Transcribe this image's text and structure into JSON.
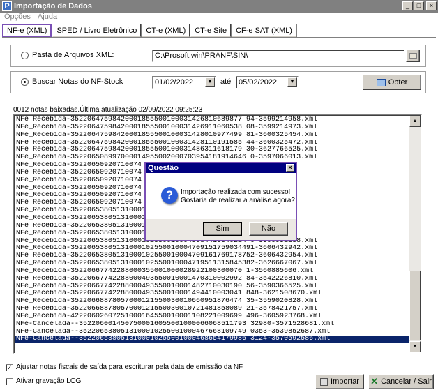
{
  "window": {
    "title": "Importação de Dados",
    "icon_letter": "P",
    "btn_min": "_",
    "btn_max": "□",
    "btn_close": "×"
  },
  "menu": [
    "Opções",
    "Ajuda"
  ],
  "tabs": [
    "NF-e (XML)",
    "SPED / Livro Eletrônico",
    "CT-e (XML)",
    "CT-e Site",
    "CF-e SAT (XML)"
  ],
  "folder": {
    "label": "Pasta de Arquivos XML:",
    "value": "C:\\Prosoft.win\\PRANF\\SIN\\"
  },
  "search": {
    "label": "Buscar Notas do NF-Stock",
    "date_from": "01/02/2022",
    "date_sep": "até",
    "date_to": "05/02/2022",
    "button": "Obter"
  },
  "status": "0012 notas baixadas.Última atualização 02/09/2022 09:25:23",
  "files": [
    "NFe_Recebida-35220647598420001855500100031426810689877 94-3599214958.xml",
    "NFe_Recebida-35220647598420001855500100031426911060538 08-3599214973.xml",
    "NFe_Recebida-35220647598420001855500100031428010977499 81-3600325454.xml",
    "NFe_Recebida-35220647598420001855500100031428110191585 44-3600325472.xml",
    "NFe_Recebida-35220647598420001855500100031486311618179 30-3627766525.xml",
    "NFe_Recebida-352206508997000014955002000703954181914646 0-3597066013.xml",
    "NFe_Recebida-35220650920710074",
    "NFe_Recebida-35220650920710074",
    "NFe_Recebida-35220650920710074",
    "NFe_Recebida-35220650920710074",
    "NFe_Recebida-35220650920710074",
    "NFe_Recebida-35220650920710074",
    "NFe_Recebida-35220653805131000102",
    "NFe_Recebida-35220653805131000102",
    "NFe_Recebida-35220653805131000102",
    "NFe_Recebida-35220653805131000102",
    "NFe_Recebida-35220653805131000102550010004698441334022470-3590952258.xml",
    "NFe_Recebida-35220653805131000102550010004709151759034491-3606432942.xml",
    "NFe_Recebida-35220653805131000102550010004709161769178752-3606432954.xml",
    "NFe_Recebida-35220653805131000102550010004719511315845382-3626667067.xml",
    "NFe_Recebida-35220667742288000355001000028922100300070 1-3560885606.xml",
    "NFe_Recebida-35220667742288000493550010001470310002992 84-3542226810.xml",
    "NFe_Recebida-35220667742288000493550010001482710030190 56-3590366525.xml",
    "NFe_Recebida-35220667742288000493550010001494410003041 848-3621508670.xml",
    "NFe_Recebida-35220668878057000121550030010660951876474 35-3559020828.xml",
    "NFe_Recebida-35220668878057000121550030010721481858089 21-3578421757.xml",
    "NFe_Recebida-42220602607251000164550010001108221009699 496-3605923768.xml",
    "NFe-Cancelada--3522060014507500016055001000066068511793 32980-3571528681.xml",
    "NFe-Cancelada--3522065380513100010255001000467668109749 0353-3539852687.xml",
    "NFe-Cancelada--3522065380513100010255001000468654179986 3124-3570592586.xml"
  ],
  "options": {
    "adjust": "Ajustar notas fiscais de saída para escriturar pela data de emissão da NF",
    "log": "Ativar gravação LOG"
  },
  "buttons": {
    "import": "Importar",
    "cancel": "Cancelar / Sair"
  },
  "dialog": {
    "title": "Questão",
    "icon": "?",
    "line1": "Importação realizada com sucesso!",
    "line2": "Gostaria de realizar a análise agora?",
    "yes": "Sim",
    "no": "Não"
  }
}
